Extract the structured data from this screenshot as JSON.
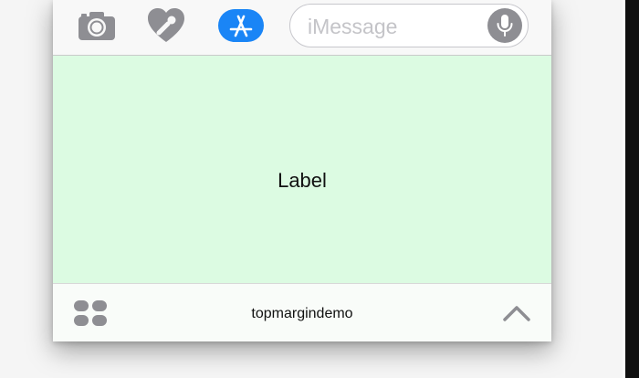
{
  "toolbar": {
    "icons": [
      "camera-icon",
      "digital-touch-heart-icon",
      "app-store-icon",
      "microphone-icon"
    ],
    "message_placeholder": "iMessage"
  },
  "extension": {
    "label": "Label",
    "background": "#dcfbe2"
  },
  "bottom_bar": {
    "app_name": "topmargindemo",
    "icons": [
      "app-drawer-icon",
      "chevron-up-icon"
    ]
  },
  "colors": {
    "accent": "#1a85f6",
    "icon_gray": "#8e8e93"
  }
}
